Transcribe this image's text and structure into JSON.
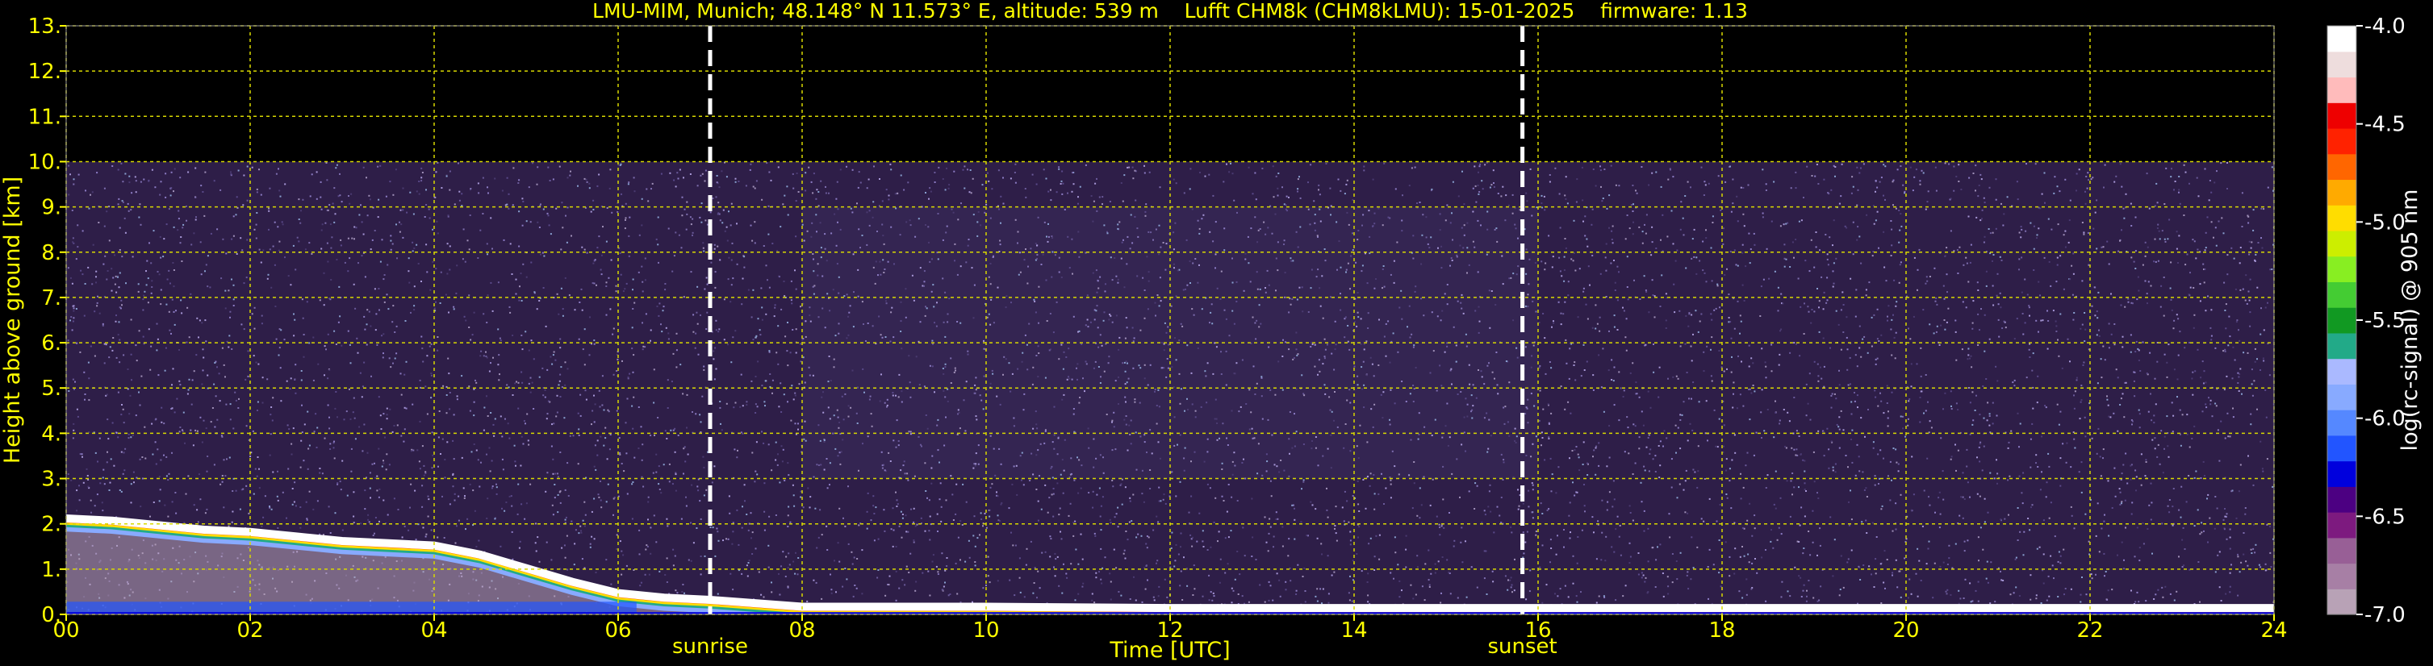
{
  "chart_data": {
    "type": "heatmap",
    "title": "LMU-MIM, Munich; 48.148° N 11.573° E, altitude: 539 m    Lufft CHM8k (CHM8kLMU): 15-01-2025    firmware: 1.13",
    "xlabel": "Time [UTC]",
    "ylabel": "Height above ground [km]",
    "xlim": [
      0,
      24
    ],
    "ylim": [
      0,
      13
    ],
    "x_ticks": [
      0,
      2,
      4,
      6,
      8,
      10,
      12,
      14,
      16,
      18,
      20,
      22,
      24
    ],
    "x_tick_labels": [
      "00",
      "02",
      "04",
      "06",
      "08",
      "10",
      "12",
      "14",
      "16",
      "18",
      "20",
      "22",
      "24"
    ],
    "y_ticks": [
      0,
      1,
      2,
      3,
      4,
      5,
      6,
      7,
      8,
      9,
      10,
      11,
      12,
      13
    ],
    "y_tick_labels": [
      "0.",
      "1.",
      "2.",
      "3.",
      "4.",
      "5.",
      "6.",
      "7.",
      "8.",
      "9.",
      "10.",
      "11.",
      "12.",
      "13."
    ],
    "grid": true,
    "data_top_km": 10,
    "markers": [
      {
        "label": "sunrise",
        "time": 7.0
      },
      {
        "label": "sunset",
        "time": 15.83
      }
    ],
    "cloud_layer_km": [
      [
        0.0,
        2.1
      ],
      [
        0.5,
        2.05
      ],
      [
        1.0,
        1.95
      ],
      [
        1.5,
        1.85
      ],
      [
        2.0,
        1.8
      ],
      [
        2.5,
        1.7
      ],
      [
        3.0,
        1.6
      ],
      [
        3.5,
        1.55
      ],
      [
        4.0,
        1.5
      ],
      [
        4.5,
        1.3
      ],
      [
        5.0,
        1.0
      ],
      [
        5.5,
        0.7
      ],
      [
        6.0,
        0.45
      ],
      [
        6.5,
        0.35
      ],
      [
        7.0,
        0.3
      ],
      [
        8.0,
        0.15
      ],
      [
        10.0,
        0.15
      ],
      [
        12.0,
        0.12
      ],
      [
        14.0,
        0.12
      ],
      [
        16.0,
        0.12
      ],
      [
        18.0,
        0.12
      ],
      [
        20.0,
        0.12
      ],
      [
        22.0,
        0.12
      ],
      [
        24.0,
        0.12
      ]
    ],
    "colorbar": {
      "label": "log(rc-signal) @ 905 nm",
      "min": -7.0,
      "max": -4.0,
      "ticks": [
        -4.0,
        -4.5,
        -5.0,
        -5.5,
        -6.0,
        -6.5,
        -7.0
      ],
      "tick_labels": [
        "-4.0",
        "-4.5",
        "-5.0",
        "-5.5",
        "-6.0",
        "-6.5",
        "-7.0"
      ],
      "colors": [
        "#b8a2b6",
        "#a77fa5",
        "#985f96",
        "#7d1a7f",
        "#4c0082",
        "#0000dd",
        "#2255ff",
        "#5588ff",
        "#88aaff",
        "#aab9ff",
        "#22aa88",
        "#119922",
        "#44cc33",
        "#88ee22",
        "#ccee00",
        "#ffdd00",
        "#ffaa00",
        "#ff6600",
        "#ff2200",
        "#ee0000",
        "#ffbbbb",
        "#eedddd",
        "#ffffff"
      ]
    }
  },
  "colors": {
    "background": "#000000",
    "text": "#ffff00",
    "grid": "#d8d800",
    "colorbar_text": "#ffffff",
    "marker_line": "#ffffff"
  }
}
